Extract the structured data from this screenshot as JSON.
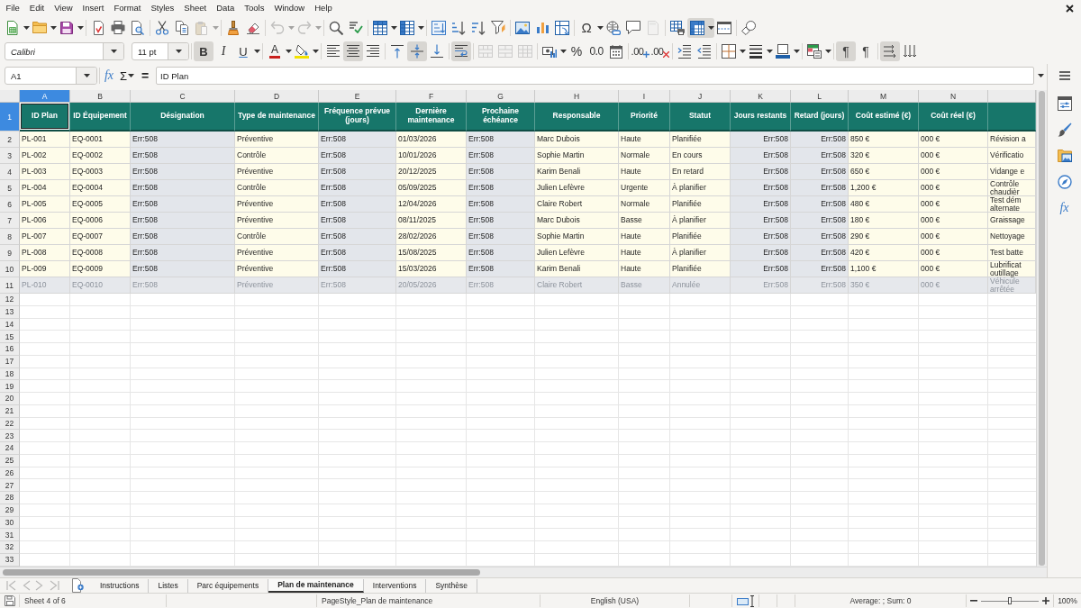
{
  "menu_bar": [
    "File",
    "Edit",
    "View",
    "Insert",
    "Format",
    "Styles",
    "Sheet",
    "Data",
    "Tools",
    "Window",
    "Help"
  ],
  "standard_toolbar": [
    [
      {
        "kind": "new",
        "dropdown": true,
        "disabled": false
      },
      {
        "kind": "open",
        "dropdown": true,
        "disabled": false
      },
      {
        "kind": "save",
        "dropdown": true,
        "disabled": false
      }
    ],
    [
      {
        "kind": "export_pdf",
        "disabled": false
      },
      {
        "kind": "print",
        "disabled": false
      },
      {
        "kind": "print_preview",
        "disabled": false
      }
    ],
    [
      {
        "kind": "cut",
        "disabled": false
      },
      {
        "kind": "copy",
        "disabled": false
      },
      {
        "kind": "paste",
        "dropdown": true,
        "disabled": true
      }
    ],
    [
      {
        "kind": "clone_formatting",
        "disabled": false
      },
      {
        "kind": "clear_formatting",
        "disabled": false
      }
    ],
    [
      {
        "kind": "undo",
        "dropdown": true,
        "disabled": true
      },
      {
        "kind": "redo",
        "dropdown": true,
        "disabled": true
      }
    ],
    [
      {
        "kind": "find_replace",
        "disabled": false
      },
      {
        "kind": "spelling",
        "disabled": false
      }
    ],
    [
      {
        "kind": "rows",
        "dropdown": true,
        "disabled": false
      },
      {
        "kind": "columns",
        "dropdown": true,
        "disabled": false
      }
    ],
    [
      {
        "kind": "sort",
        "disabled": false
      },
      {
        "kind": "sort_ascending",
        "disabled": false
      },
      {
        "kind": "sort_descending",
        "disabled": false
      },
      {
        "kind": "autofilter",
        "disabled": false
      }
    ],
    [
      {
        "kind": "image",
        "disabled": false
      },
      {
        "kind": "chart",
        "disabled": false
      },
      {
        "kind": "pivot_table",
        "disabled": false
      }
    ],
    [
      {
        "kind": "special_character",
        "glyph": "Ω",
        "dropdown": true,
        "disabled": false
      },
      {
        "kind": "hyperlink",
        "disabled": false
      },
      {
        "kind": "comment",
        "disabled": false
      },
      {
        "kind": "header_footer",
        "disabled": true
      }
    ],
    [
      {
        "kind": "print_area",
        "disabled": false
      },
      {
        "kind": "freeze",
        "dropdown": true,
        "on": true,
        "disabled": false
      },
      {
        "kind": "split_window",
        "on": false,
        "disabled": false
      }
    ],
    [
      {
        "kind": "draw_functions",
        "on": false,
        "disabled": false
      }
    ]
  ],
  "formatting_toolbar": {
    "font_name": "Calibri",
    "font_size": "11 pt",
    "groups": [
      [
        {
          "kind": "bold",
          "glyph": "B",
          "on": true,
          "disabled": false
        },
        {
          "kind": "italic",
          "glyph": "I",
          "on": false,
          "disabled": false
        },
        {
          "kind": "underline",
          "glyph": "U",
          "dropdown": true,
          "on": false,
          "disabled": false
        }
      ],
      [
        {
          "kind": "font_color",
          "glyph": "A",
          "dropdown": true,
          "disabled": false
        },
        {
          "kind": "highlight",
          "dropdown": true,
          "disabled": false
        }
      ],
      [
        {
          "kind": "align_left",
          "on": false,
          "disabled": false
        },
        {
          "kind": "align_center",
          "on": true,
          "disabled": false
        },
        {
          "kind": "align_right",
          "on": false,
          "disabled": false
        }
      ],
      [
        {
          "kind": "align_top",
          "on": false,
          "disabled": false
        },
        {
          "kind": "align_middle",
          "on": true,
          "disabled": false
        },
        {
          "kind": "align_bottom",
          "on": false,
          "disabled": false
        }
      ],
      [
        {
          "kind": "wrap_text",
          "on": true,
          "disabled": false
        }
      ],
      [
        {
          "kind": "merge_center",
          "on": false,
          "disabled": true
        },
        {
          "kind": "merge_cells",
          "on": false,
          "disabled": true
        },
        {
          "kind": "unmerge_cells",
          "on": false,
          "disabled": true
        }
      ],
      [
        {
          "kind": "number_format",
          "dropdown": true,
          "disabled": false
        },
        {
          "kind": "percent",
          "glyph": "%",
          "disabled": false
        },
        {
          "kind": "number",
          "glyph": "0.0",
          "disabled": false
        },
        {
          "kind": "date",
          "disabled": false
        }
      ],
      [
        {
          "kind": "add_decimal",
          "glyph": ".00",
          "disabled": false
        },
        {
          "kind": "delete_decimal",
          "glyph": ".00",
          "disabled": false
        }
      ],
      [
        {
          "kind": "indent_increase",
          "disabled": false
        },
        {
          "kind": "indent_decrease",
          "disabled": false
        }
      ],
      [
        {
          "kind": "borders",
          "dropdown": true,
          "disabled": false
        },
        {
          "kind": "border_style",
          "dropdown": true,
          "disabled": false
        },
        {
          "kind": "border_color",
          "dropdown": true,
          "disabled": false
        }
      ],
      [
        {
          "kind": "conditional",
          "dropdown": true,
          "disabled": false
        }
      ],
      [
        {
          "kind": "left_to_right",
          "glyph": "¶",
          "on": true,
          "disabled": false
        },
        {
          "kind": "right_to_left",
          "glyph": "¶",
          "on": false,
          "disabled": false
        }
      ],
      [
        {
          "kind": "text_horizontal",
          "on": true,
          "disabled": false
        },
        {
          "kind": "text_vertical",
          "on": false,
          "disabled": false
        }
      ]
    ]
  },
  "formula_bar": {
    "name_box": "A1",
    "buttons": [
      {
        "kind": "function_wizard",
        "glyph": "fx"
      },
      {
        "kind": "sum",
        "glyph": "Σ",
        "dropdown": true
      },
      {
        "kind": "formula",
        "glyph": "="
      }
    ],
    "content": "ID Plan"
  },
  "sidebar": [
    {
      "kind": "properties"
    },
    {
      "kind": "styles"
    },
    {
      "kind": "gallery"
    },
    {
      "kind": "navigator"
    },
    {
      "kind": "functions",
      "glyph": "fx"
    }
  ],
  "sheet": {
    "columns": [
      {
        "letter": "A",
        "selected": true,
        "kind": "input"
      },
      {
        "letter": "B",
        "selected": false,
        "kind": "input"
      },
      {
        "letter": "C",
        "selected": false,
        "kind": "formula"
      },
      {
        "letter": "D",
        "selected": false,
        "kind": "input"
      },
      {
        "letter": "E",
        "selected": false,
        "kind": "formula"
      },
      {
        "letter": "F",
        "selected": false,
        "kind": "input"
      },
      {
        "letter": "G",
        "selected": false,
        "kind": "formula"
      },
      {
        "letter": "H",
        "selected": false,
        "kind": "input"
      },
      {
        "letter": "I",
        "selected": false,
        "kind": "input"
      },
      {
        "letter": "J",
        "selected": false,
        "kind": "input"
      },
      {
        "letter": "K",
        "selected": false,
        "kind": "formula_number"
      },
      {
        "letter": "L",
        "selected": false,
        "kind": "formula_number"
      },
      {
        "letter": "M",
        "selected": false,
        "kind": "input"
      },
      {
        "letter": "N",
        "selected": false,
        "kind": "input"
      }
    ],
    "rows": [
      {
        "number": "1",
        "selected": true,
        "kind": "header",
        "cells": [
          "ID Plan",
          "ID Équipement",
          "Désignation",
          "Type de maintenance",
          "Fréquence prévue (jours)",
          "Dernière maintenance",
          "Prochaine échéance",
          "Responsable",
          "Priorité",
          "Statut",
          "Jours restants",
          "Retard (jours)",
          "Coût estimé (€)",
          "Coût réel (€)"
        ]
      },
      {
        "number": "2",
        "selected": false,
        "kind": "data",
        "greyed": false,
        "cells": [
          "PL-001",
          "EQ-0001",
          "Err:508",
          "Préventive",
          "Err:508",
          "01/03/2026",
          "Err:508",
          "Marc Dubois",
          "Haute",
          "Planifiée",
          "Err:508",
          "Err:508",
          "850 €",
          "000 €",
          "Révision a"
        ]
      },
      {
        "number": "3",
        "selected": false,
        "kind": "data",
        "greyed": false,
        "cells": [
          "PL-002",
          "EQ-0002",
          "Err:508",
          "Contrôle",
          "Err:508",
          "10/01/2026",
          "Err:508",
          "Sophie Martin",
          "Normale",
          "En cours",
          "Err:508",
          "Err:508",
          "320 €",
          "000 €",
          "Vérificatio"
        ]
      },
      {
        "number": "4",
        "selected": false,
        "kind": "data",
        "greyed": false,
        "cells": [
          "PL-003",
          "EQ-0003",
          "Err:508",
          "Préventive",
          "Err:508",
          "20/12/2025",
          "Err:508",
          "Karim Benali",
          "Haute",
          "En retard",
          "Err:508",
          "Err:508",
          "650 €",
          "000 €",
          "Vidange e"
        ]
      },
      {
        "number": "5",
        "selected": false,
        "kind": "data",
        "greyed": false,
        "cells": [
          "PL-004",
          "EQ-0004",
          "Err:508",
          "Contrôle",
          "Err:508",
          "05/09/2025",
          "Err:508",
          "Julien Lefèvre",
          "Urgente",
          "À planifier",
          "Err:508",
          "Err:508",
          "1,200 €",
          "000 €",
          "Contrôle\nchaudièr"
        ]
      },
      {
        "number": "6",
        "selected": false,
        "kind": "data",
        "greyed": false,
        "cells": [
          "PL-005",
          "EQ-0005",
          "Err:508",
          "Préventive",
          "Err:508",
          "12/04/2026",
          "Err:508",
          "Claire Robert",
          "Normale",
          "Planifiée",
          "Err:508",
          "Err:508",
          "480 €",
          "000 €",
          "Test dém\nalternate"
        ]
      },
      {
        "number": "7",
        "selected": false,
        "kind": "data",
        "greyed": false,
        "cells": [
          "PL-006",
          "EQ-0006",
          "Err:508",
          "Préventive",
          "Err:508",
          "08/11/2025",
          "Err:508",
          "Marc Dubois",
          "Basse",
          "À planifier",
          "Err:508",
          "Err:508",
          "180 €",
          "000 €",
          "Graissage"
        ]
      },
      {
        "number": "8",
        "selected": false,
        "kind": "data",
        "greyed": false,
        "cells": [
          "PL-007",
          "EQ-0007",
          "Err:508",
          "Contrôle",
          "Err:508",
          "28/02/2026",
          "Err:508",
          "Sophie Martin",
          "Haute",
          "Planifiée",
          "Err:508",
          "Err:508",
          "290 €",
          "000 €",
          "Nettoyage"
        ]
      },
      {
        "number": "9",
        "selected": false,
        "kind": "data",
        "greyed": false,
        "cells": [
          "PL-008",
          "EQ-0008",
          "Err:508",
          "Préventive",
          "Err:508",
          "15/08/2025",
          "Err:508",
          "Julien Lefèvre",
          "Haute",
          "À planifier",
          "Err:508",
          "Err:508",
          "420 €",
          "000 €",
          "Test batte"
        ]
      },
      {
        "number": "10",
        "selected": false,
        "kind": "data",
        "greyed": false,
        "cells": [
          "PL-009",
          "EQ-0009",
          "Err:508",
          "Préventive",
          "Err:508",
          "15/03/2026",
          "Err:508",
          "Karim Benali",
          "Haute",
          "Planifiée",
          "Err:508",
          "Err:508",
          "1,100 €",
          "000 €",
          "Lubrificat\noutillage"
        ]
      },
      {
        "number": "11",
        "selected": false,
        "kind": "data",
        "greyed": true,
        "cells": [
          "PL-010",
          "EQ-0010",
          "Err:508",
          "Préventive",
          "Err:508",
          "20/05/2026",
          "Err:508",
          "Claire Robert",
          "Basse",
          "Annulée",
          "Err:508",
          "Err:508",
          "350 €",
          "000 €",
          "Véhicule\narrêtée"
        ]
      },
      {
        "number": "12",
        "selected": false,
        "kind": "empty"
      },
      {
        "number": "13",
        "selected": false,
        "kind": "empty"
      },
      {
        "number": "14",
        "selected": false,
        "kind": "empty"
      },
      {
        "number": "15",
        "selected": false,
        "kind": "empty"
      },
      {
        "number": "16",
        "selected": false,
        "kind": "empty"
      },
      {
        "number": "17",
        "selected": false,
        "kind": "empty"
      },
      {
        "number": "18",
        "selected": false,
        "kind": "empty"
      },
      {
        "number": "19",
        "selected": false,
        "kind": "empty"
      },
      {
        "number": "20",
        "selected": false,
        "kind": "empty"
      },
      {
        "number": "21",
        "selected": false,
        "kind": "empty"
      },
      {
        "number": "22",
        "selected": false,
        "kind": "empty"
      },
      {
        "number": "23",
        "selected": false,
        "kind": "empty"
      },
      {
        "number": "24",
        "selected": false,
        "kind": "empty"
      },
      {
        "number": "25",
        "selected": false,
        "kind": "empty"
      },
      {
        "number": "26",
        "selected": false,
        "kind": "empty"
      },
      {
        "number": "27",
        "selected": false,
        "kind": "empty"
      },
      {
        "number": "28",
        "selected": false,
        "kind": "empty"
      },
      {
        "number": "29",
        "selected": false,
        "kind": "empty"
      },
      {
        "number": "30",
        "selected": false,
        "kind": "empty"
      },
      {
        "number": "31",
        "selected": false,
        "kind": "empty"
      },
      {
        "number": "32",
        "selected": false,
        "kind": "empty"
      },
      {
        "number": "33",
        "selected": false,
        "kind": "empty"
      }
    ]
  },
  "sheet_tab_navigation": [
    {
      "kind": "first",
      "disabled": true
    },
    {
      "kind": "previous",
      "disabled": true
    },
    {
      "kind": "next",
      "disabled": true
    },
    {
      "kind": "last",
      "disabled": true
    }
  ],
  "sheet_tabs": [
    {
      "label": "Instructions",
      "selected": false
    },
    {
      "label": "Listes",
      "selected": false
    },
    {
      "label": "Parc équipements",
      "selected": false
    },
    {
      "label": "Plan de maintenance",
      "selected": true
    },
    {
      "label": "Interventions",
      "selected": false
    },
    {
      "label": "Synthèse",
      "selected": false
    }
  ],
  "status_bar": {
    "sheet": "Sheet 4 of 6",
    "page_style": "PageStyle_Plan de maintenance",
    "language": "English (USA)",
    "summary": "Average: ; Sum: 0",
    "zoom_slider": {
      "level": 0.5
    },
    "zoom": "100%"
  }
}
